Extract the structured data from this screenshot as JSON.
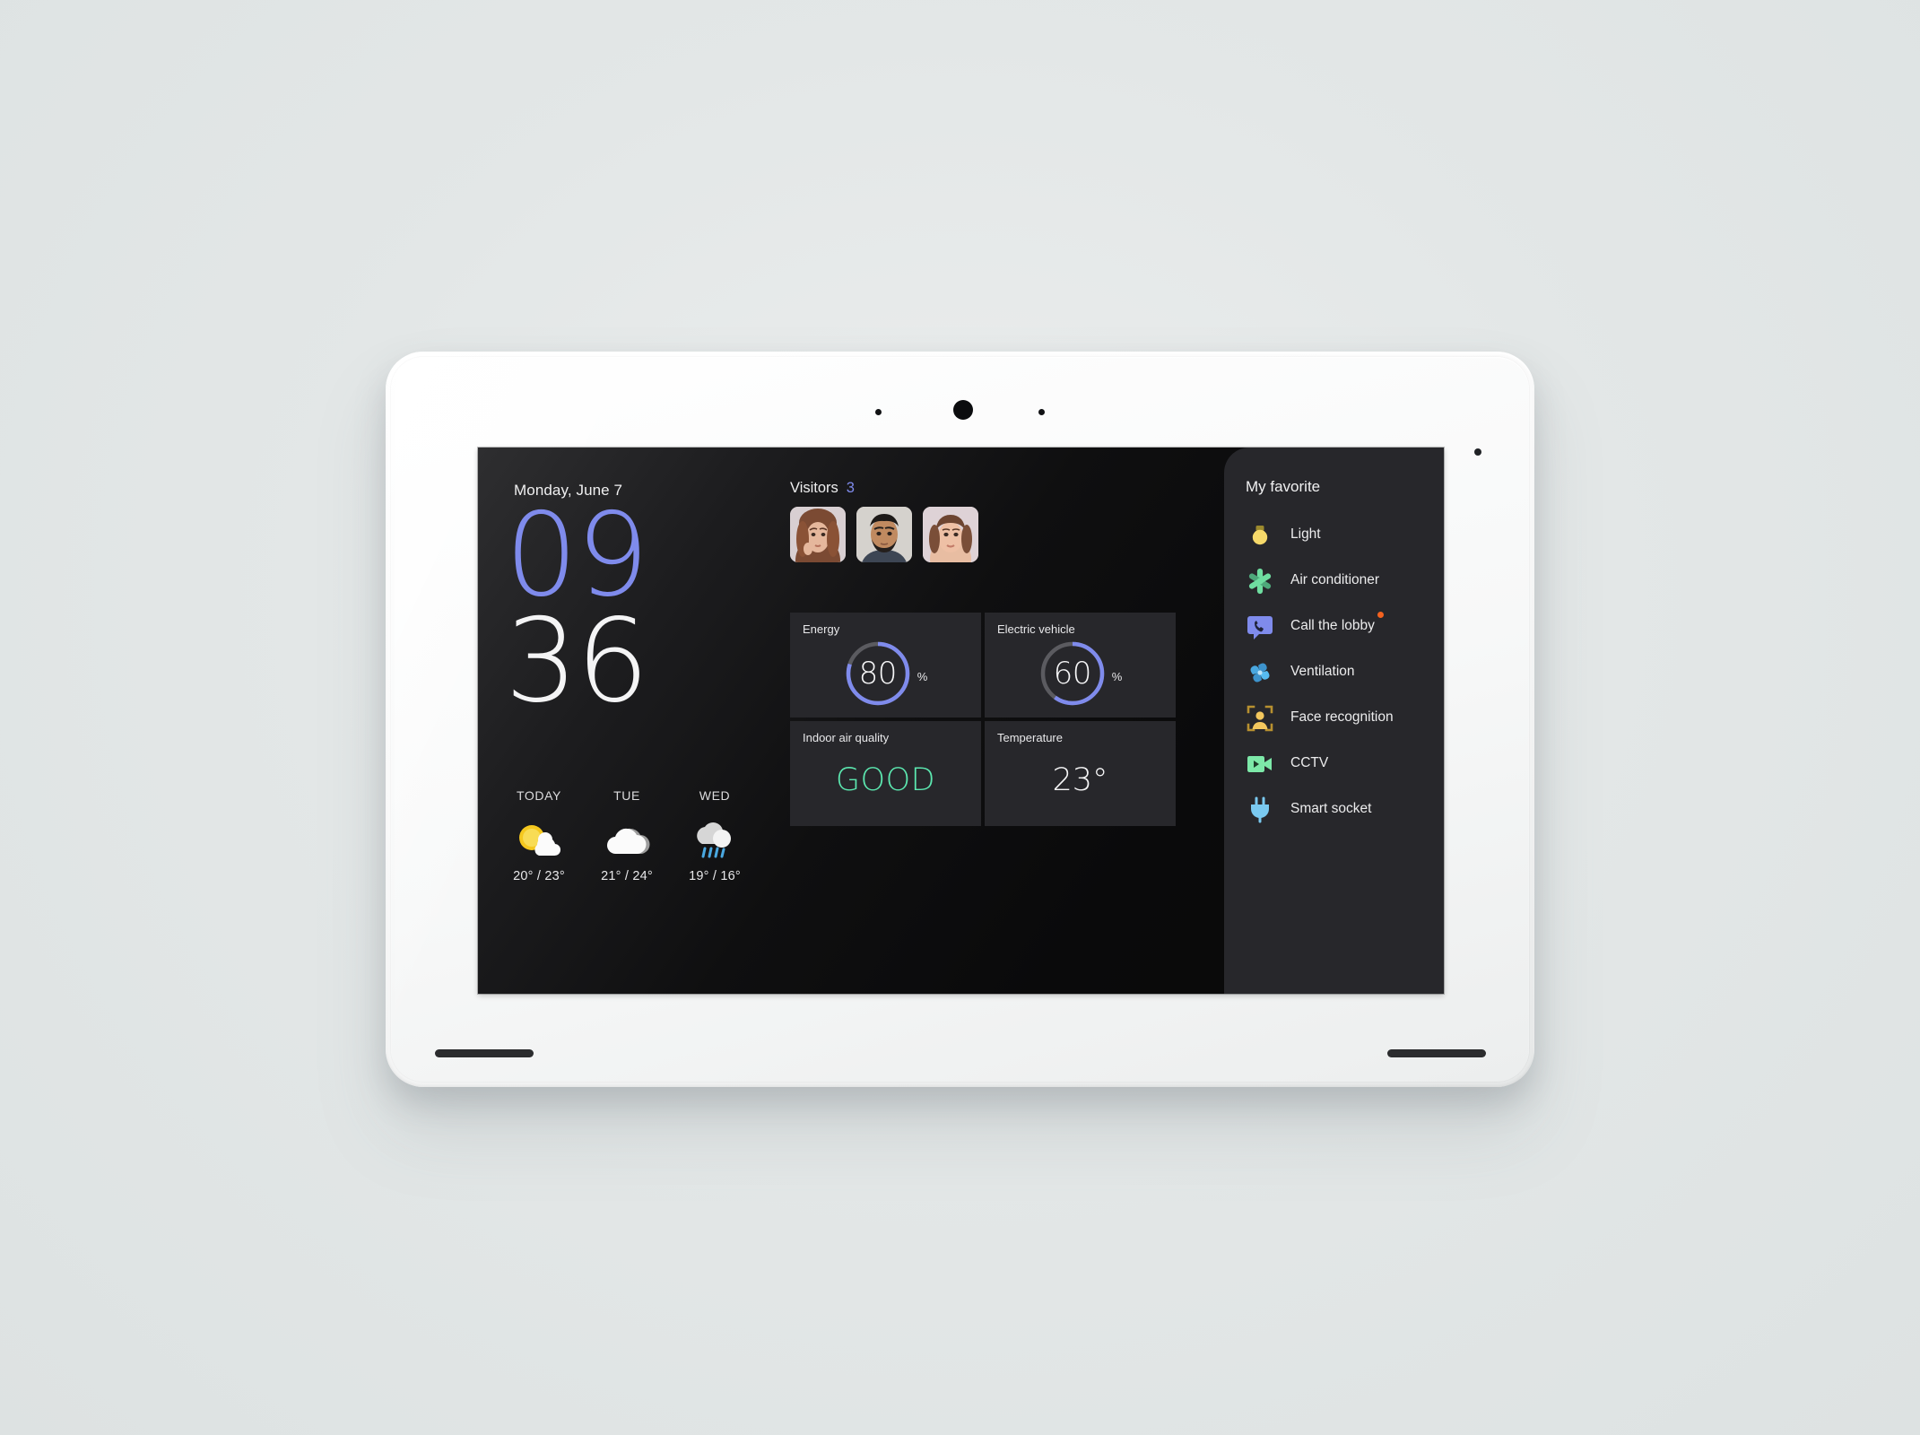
{
  "device": {
    "name": "smart-home-control-panel",
    "sensors": [
      "proximity-sensor",
      "front-camera",
      "light-sensor",
      "status-led"
    ],
    "speakers": [
      "speaker-grille-left",
      "speaker-grille-right"
    ]
  },
  "screen": {
    "clock": {
      "date": "Monday, June 7",
      "hour": "09",
      "minute": "36",
      "hour_color": "#7f8bec",
      "minute_color": "#f4f4f5"
    },
    "forecast": [
      {
        "day": "TODAY",
        "icon": "sun-behind-cloud-icon",
        "temps": "20° / 23°"
      },
      {
        "day": "TUE",
        "icon": "cloud-icon",
        "temps": "21° / 24°"
      },
      {
        "day": "WED",
        "icon": "cloud-with-rain-icon",
        "temps": "19° / 16°"
      }
    ],
    "visitors": {
      "label": "Visitors",
      "count": "3",
      "count_color": "#7f8bec",
      "people": [
        {
          "name": "visitor-photo-1",
          "alt": "woman with long auburn hair"
        },
        {
          "name": "visitor-photo-2",
          "alt": "man with dark beard"
        },
        {
          "name": "visitor-photo-3",
          "alt": "woman with fringe haircut"
        }
      ]
    },
    "stats": [
      {
        "id": "energy",
        "title": "Energy",
        "type": "gauge",
        "value": "80",
        "unit": "%",
        "percent": 80,
        "ring_color": "#7f8bec",
        "track_color": "#5b5b60"
      },
      {
        "id": "electric-vehicle",
        "title": "Electric vehicle",
        "type": "gauge",
        "value": "60",
        "unit": "%",
        "percent": 60,
        "ring_color": "#7f8bec",
        "track_color": "#5b5b60"
      },
      {
        "id": "indoor-air-quality",
        "title": "Indoor air quality",
        "type": "text",
        "value": "GOOD",
        "value_color": "#5ce8b0"
      },
      {
        "id": "temperature",
        "title": "Temperature",
        "type": "text",
        "value": "23°",
        "value_color": "#f6f6f7"
      }
    ],
    "favorites": {
      "title": "My favorite",
      "items": [
        {
          "label": "Light",
          "icon": "light-bulb-icon",
          "color": "#f6d96a",
          "badge": false
        },
        {
          "label": "Air conditioner",
          "icon": "snowflake-icon",
          "color": "#6fdda0",
          "badge": false
        },
        {
          "label": "Call the lobby",
          "icon": "phone-bubble-icon",
          "color": "#7f8bec",
          "badge": true,
          "badge_color": "#f4621f"
        },
        {
          "label": "Ventilation",
          "icon": "fan-pinwheel-icon",
          "color": "#4aa8e0",
          "badge": false
        },
        {
          "label": "Face recognition",
          "icon": "face-recognition-icon",
          "color": "#f3c75e",
          "badge": false
        },
        {
          "label": "CCTV",
          "icon": "video-camera-icon",
          "color": "#7de8a8",
          "badge": false
        },
        {
          "label": "Smart socket",
          "icon": "power-plug-icon",
          "color": "#7ac9f0",
          "badge": false
        }
      ]
    }
  }
}
